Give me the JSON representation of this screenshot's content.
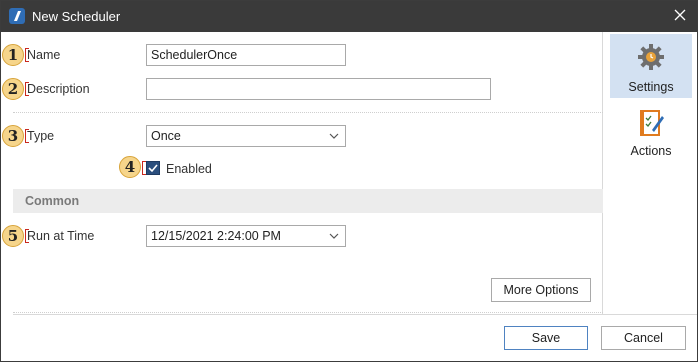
{
  "window": {
    "title": "New Scheduler"
  },
  "icons": {
    "app": "app-logo-icon",
    "close": "close-icon",
    "settings": "gear-icon",
    "actions": "clipboard-pencil-icon",
    "chevron": "chevron-down-icon",
    "check": "checkmark-icon"
  },
  "badges": [
    "1",
    "2",
    "3",
    "4",
    "5"
  ],
  "form": {
    "name_label": "Name",
    "name_value": "SchedulerOnce",
    "description_label": "Description",
    "description_value": "",
    "type_label": "Type",
    "type_value": "Once",
    "enabled_label": "Enabled",
    "enabled_checked": true,
    "common_section": "Common",
    "run_at_time_label": "Run at Time",
    "run_at_time_value": "12/15/2021 2:24:00 PM",
    "more_options_label": "More Options"
  },
  "sidebar": {
    "items": [
      {
        "label": "Settings",
        "active": true
      },
      {
        "label": "Actions",
        "active": false
      }
    ]
  },
  "footer": {
    "save_label": "Save",
    "cancel_label": "Cancel"
  },
  "colors": {
    "titlebar": "#3a3a3a",
    "accent": "#2a4e7d",
    "active_tab": "#d3e1f2",
    "badge": "#f6d58b",
    "marker": "#c8281e"
  }
}
